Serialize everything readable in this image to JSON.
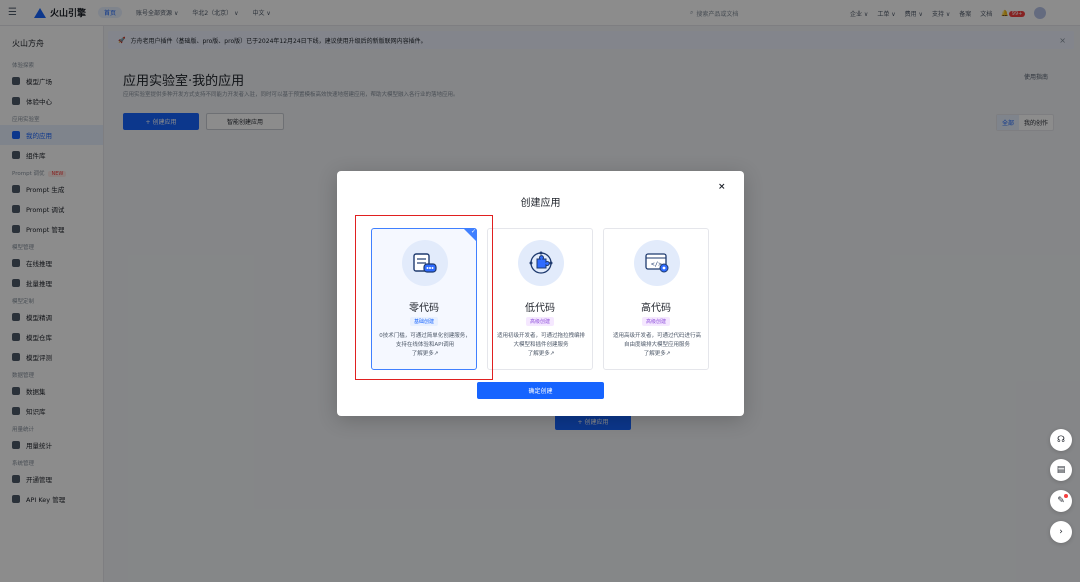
{
  "topbar": {
    "brand": "火山引擎",
    "home": "首页",
    "workspace": "账号全部资源 ∨",
    "region": "华北2（北京） ∨",
    "language": "中文 ∨",
    "search_placeholder": "搜索产品或文档",
    "links": [
      "企业 ∨",
      "工单 ∨",
      "费用 ∨",
      "支持 ∨",
      "备案",
      "文档"
    ],
    "badge": "99+"
  },
  "sidebar": {
    "title": "火山方舟",
    "sections": [
      {
        "group": "体验探索",
        "items": [
          {
            "label": "模型广场",
            "icon": "grid-icon"
          },
          {
            "label": "体验中心",
            "icon": "lab-icon"
          }
        ]
      },
      {
        "group": "应用实验室",
        "items": [
          {
            "label": "我的应用",
            "icon": "app-icon",
            "active": true
          },
          {
            "label": "组件库",
            "icon": "component-icon"
          }
        ]
      },
      {
        "group": "Prompt 调优",
        "tag": "NEW",
        "items": [
          {
            "label": "Prompt 生成",
            "icon": "prompt-icon"
          },
          {
            "label": "Prompt 调试",
            "icon": "debug-icon"
          },
          {
            "label": "Prompt 管理",
            "icon": "manage-icon"
          }
        ]
      },
      {
        "group": "模型管理",
        "items": [
          {
            "label": "在线推理",
            "icon": "inference-icon"
          },
          {
            "label": "批量推理",
            "icon": "batch-icon"
          }
        ]
      },
      {
        "group": "模型定制",
        "items": [
          {
            "label": "模型精调",
            "icon": "tune-icon"
          },
          {
            "label": "模型仓库",
            "icon": "repo-icon"
          },
          {
            "label": "模型评测",
            "icon": "eval-icon"
          }
        ]
      },
      {
        "group": "数据管理",
        "items": [
          {
            "label": "数据集",
            "icon": "dataset-icon"
          },
          {
            "label": "知识库",
            "icon": "kb-icon"
          }
        ]
      },
      {
        "group": "用量统计",
        "items": [
          {
            "label": "用量统计",
            "icon": "usage-icon"
          }
        ]
      },
      {
        "group": "系统管理",
        "items": [
          {
            "label": "开通管理",
            "icon": "open-icon"
          },
          {
            "label": "API Key 管理",
            "icon": "key-icon"
          }
        ]
      }
    ]
  },
  "notice": {
    "text": "方舟老用户插件（基础版、pro版、pro版）已于2024年12月24日下线，建议使用升级后的新版联网内容插件。"
  },
  "page": {
    "title": "应用实验室·我的应用",
    "description": "应用实验室提供多种开发方式支持不同能力开发者入驻，同时可以基于预置模板高效快速地搭建应用，帮助大模型融入各行业的落地应用。",
    "history": "使用指南",
    "create_button": "+ 创建应用",
    "smart_button": "智能创建应用",
    "segments": [
      "全部",
      "我的创作"
    ],
    "center_create": "+ 创建应用"
  },
  "modal": {
    "title": "创建应用",
    "close": "×",
    "confirm": "确定创建",
    "cards": [
      {
        "label": "零代码",
        "tag": "基础创建",
        "tag_style": "basic",
        "desc": "0技术门槛，可通过简单化创建服务，支持在线体验和API调用",
        "more": "了解更多↗",
        "selected": true,
        "icon": "chat-document-icon"
      },
      {
        "label": "低代码",
        "tag": "高级创建",
        "tag_style": "adv",
        "desc": "适用初级开发者，可通过拖拉拽编排大模型和插件创建服务",
        "more": "了解更多↗",
        "selected": false,
        "icon": "puzzle-icon"
      },
      {
        "label": "高代码",
        "tag": "高级创建",
        "tag_style": "adv",
        "desc": "适用高级开发者，可通过代码进行高自由度编排大模型应用服务",
        "more": "了解更多↗",
        "selected": false,
        "icon": "code-window-icon"
      }
    ]
  },
  "fabs": [
    "headset-icon",
    "book-icon",
    "feedback-icon",
    "arrow-right-icon"
  ]
}
